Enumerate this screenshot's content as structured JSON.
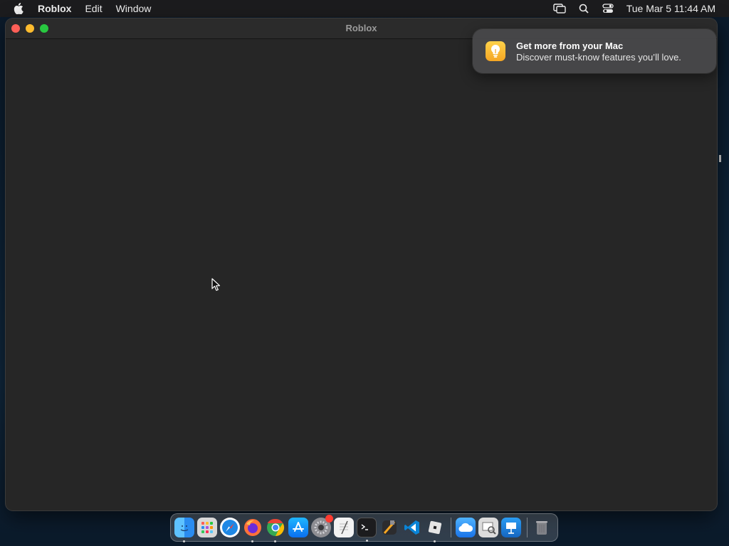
{
  "menubar": {
    "app_name": "Roblox",
    "items": [
      "Edit",
      "Window"
    ],
    "clock": "Tue Mar 5  11:44 AM",
    "icons": [
      "apple-icon",
      "screen-mirroring-icon",
      "spotlight-search-icon",
      "control-center-icon"
    ]
  },
  "window": {
    "title": "Roblox"
  },
  "notification": {
    "title": "Get more from your Mac",
    "body": "Discover must-know features you’ll love.",
    "icon": "lightbulb-icon"
  },
  "dock": {
    "apps": [
      "Finder",
      "Launchpad",
      "Safari",
      "Firefox",
      "Google Chrome",
      "App Store",
      "System Settings",
      "TextEdit",
      "Terminal",
      "Xcode",
      "Visual Studio Code",
      "Roblox",
      "iCloud Drive",
      "Preview",
      "Keynote",
      "Trash"
    ],
    "colors": {
      "finder": "#2a8cf0",
      "safari": "#1e88e5",
      "firefox": "#ff7139",
      "chrome": "#34a853",
      "vscode": "#0a84d6"
    }
  }
}
